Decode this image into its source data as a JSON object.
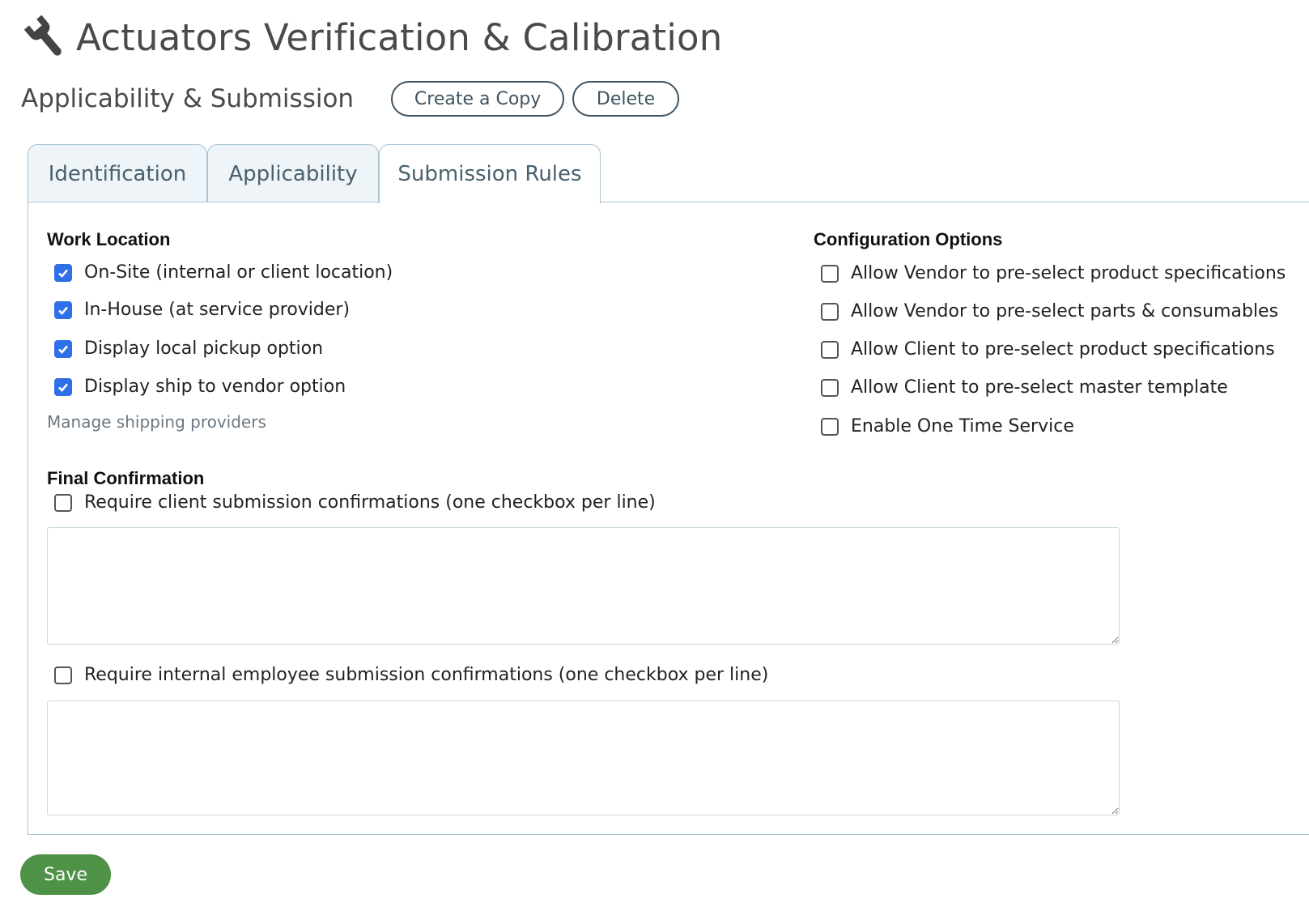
{
  "header": {
    "icon": "wrench-icon",
    "title": "Actuators Verification & Calibration",
    "subtitle": "Applicability & Submission",
    "buttons": {
      "copy": "Create a Copy",
      "delete": "Delete"
    }
  },
  "tabs": [
    {
      "label": "Identification",
      "active": false
    },
    {
      "label": "Applicability",
      "active": false
    },
    {
      "label": "Submission Rules",
      "active": true
    }
  ],
  "work_location": {
    "title": "Work Location",
    "options": [
      {
        "label": "On-Site (internal or client location)",
        "checked": true
      },
      {
        "label": "In-House (at service provider)",
        "checked": true
      },
      {
        "label": "Display local pickup option",
        "checked": true
      },
      {
        "label": "Display ship to vendor option",
        "checked": true
      }
    ],
    "link": "Manage shipping providers"
  },
  "configuration": {
    "title": "Configuration Options",
    "options": [
      {
        "label": "Allow Vendor to pre-select product specifications",
        "checked": false
      },
      {
        "label": "Allow Vendor to pre-select parts & consumables",
        "checked": false
      },
      {
        "label": "Allow Client to pre-select product specifications",
        "checked": false
      },
      {
        "label": "Allow Client to pre-select master template",
        "checked": false
      },
      {
        "label": "Enable One Time Service",
        "checked": false
      }
    ]
  },
  "final_confirmation": {
    "title": "Final Confirmation",
    "client": {
      "label": "Require client submission confirmations (one checkbox per line)",
      "checked": false,
      "value": ""
    },
    "employee": {
      "label": "Require internal employee submission confirmations (one checkbox per line)",
      "checked": false,
      "value": ""
    }
  },
  "save_label": "Save",
  "colors": {
    "checked": "#2f6fe8",
    "save": "#4d9246",
    "border": "#aac4d4",
    "pill": "#3f5461"
  }
}
